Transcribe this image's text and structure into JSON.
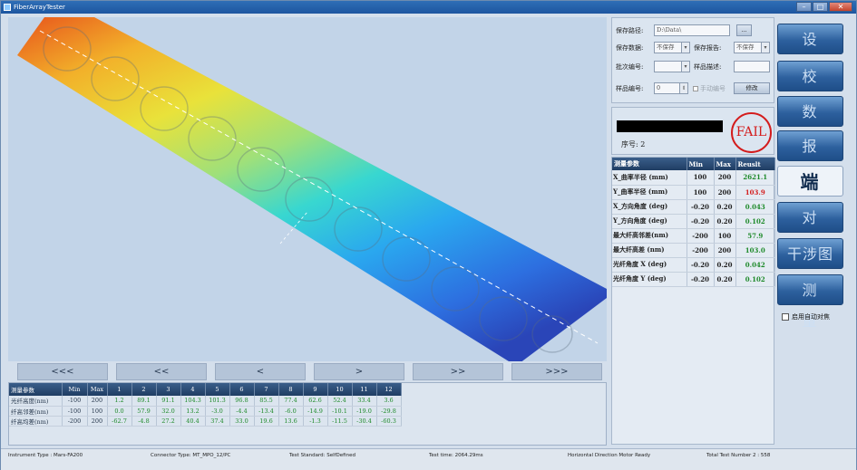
{
  "window": {
    "title": "FiberArrayTester"
  },
  "nav_buttons": [
    "<<<",
    "<<",
    "<",
    ">",
    ">>",
    ">>>"
  ],
  "measure_table": {
    "headers": [
      "测量参数",
      "Min",
      "Max",
      "1",
      "2",
      "3",
      "4",
      "5",
      "6",
      "7",
      "8",
      "9",
      "10",
      "11",
      "12"
    ],
    "rows": [
      {
        "name": "光纤高度(nm)",
        "min": "-100",
        "max": "200",
        "values": [
          "1.2",
          "89.1",
          "91.1",
          "104.3",
          "101.3",
          "96.8",
          "85.5",
          "77.4",
          "62.6",
          "52.4",
          "33.4",
          "3.6"
        ]
      },
      {
        "name": "纤高邻差(nm)",
        "min": "-100",
        "max": "100",
        "values": [
          "0.0",
          "57.9",
          "32.0",
          "13.2",
          "-3.0",
          "-4.4",
          "-13.4",
          "-6.0",
          "-14.9",
          "-10.1",
          "-19.0",
          "-29.8"
        ]
      },
      {
        "name": "纤高均差(nm)",
        "min": "-200",
        "max": "200",
        "values": [
          "-62.7",
          "-4.8",
          "27.2",
          "40.4",
          "37.4",
          "33.0",
          "19.6",
          "13.6",
          "-1.3",
          "-11.5",
          "-30.4",
          "-60.3"
        ]
      }
    ]
  },
  "settings": {
    "save_path_label": "保存路径:",
    "save_path_value": "D:\\Data\\",
    "browse_label": "...",
    "save_data_label": "保存数据:",
    "save_data_value": "不保存",
    "save_report_label": "保存报告:",
    "save_report_value": "不保存",
    "batch_label": "批次编号:",
    "sample_desc_label": "样品描述:",
    "sample_no_label": "样品编号:",
    "sample_no_value": "0",
    "manual_no_label": "手动编号",
    "modify_label": "修改"
  },
  "status": {
    "seq_text": "序号: 2",
    "result_stamp": "FAIL"
  },
  "results_table": {
    "headers": [
      "测量参数",
      "Min",
      "Max",
      "Reuslt"
    ],
    "rows": [
      {
        "name": "X_曲率半径  (mm)",
        "min": "100",
        "max": "200",
        "result": "2621.1",
        "state": "pass"
      },
      {
        "name": "Y_曲率半径  (mm)",
        "min": "100",
        "max": "200",
        "result": "103.9",
        "state": "fail"
      },
      {
        "name": "X_方向角度 (deg)",
        "min": "-0.20",
        "max": "0.20",
        "result": "0.043",
        "state": "pass"
      },
      {
        "name": "Y_方向角度 (deg)",
        "min": "-0.20",
        "max": "0.20",
        "result": "0.102",
        "state": "pass"
      },
      {
        "name": "最大纤高邻差(nm)",
        "min": "-200",
        "max": "100",
        "result": "57.9",
        "state": "pass"
      },
      {
        "name": "最大纤高差  (nm)",
        "min": "-200",
        "max": "200",
        "result": "103.0",
        "state": "pass"
      },
      {
        "name": "光纤角度 X (deg)",
        "min": "-0.20",
        "max": "0.20",
        "result": "0.042",
        "state": "pass"
      },
      {
        "name": "光纤角度 Y (deg)",
        "min": "-0.20",
        "max": "0.20",
        "result": "0.102",
        "state": "pass"
      }
    ]
  },
  "right_nav": [
    "设 置",
    "校 准",
    "数 据",
    "报 告",
    "端 面",
    "对 焦",
    "干涉图",
    "测 量"
  ],
  "active_nav": "端 面",
  "auto_focus_label": "启用自动对焦",
  "statusbar": {
    "instrument": "Instrument Type :  Mars-FA200",
    "connector": "Connector Type:  MT_MPO_12/PC",
    "standard": "Test Standard:  SelfDefined",
    "time": "Test time: 2064.29ms",
    "motor": "Horizontal Direction Motor Ready",
    "total": "Total Test Number 2  :  558"
  }
}
